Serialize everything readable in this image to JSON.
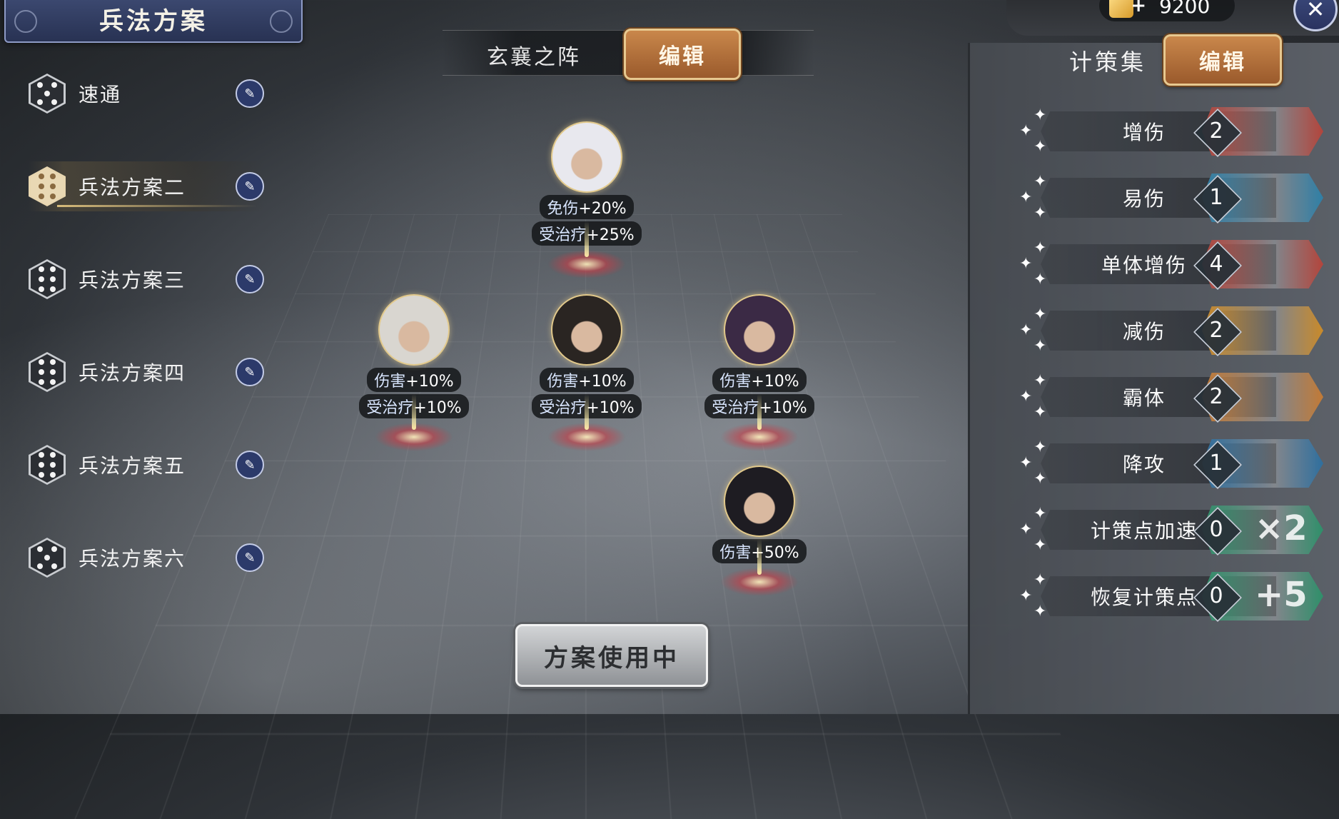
{
  "left_panel": {
    "title": "兵法方案",
    "plans": [
      {
        "label": "速通",
        "pips": 5,
        "active": false
      },
      {
        "label": "兵法方案二",
        "pips": 6,
        "active": true
      },
      {
        "label": "兵法方案三",
        "pips": 6,
        "active": false
      },
      {
        "label": "兵法方案四",
        "pips": 6,
        "active": false
      },
      {
        "label": "兵法方案五",
        "pips": 6,
        "active": false
      },
      {
        "label": "兵法方案六",
        "pips": 5,
        "active": false
      }
    ]
  },
  "formation": {
    "name": "玄襄之阵",
    "edit_label": "编辑"
  },
  "characters": [
    {
      "id": "top",
      "stats": [
        {
          "k": "免伤",
          "v": "+20%"
        },
        {
          "k": "受治疗",
          "v": "+25%"
        }
      ],
      "hair": "#e8e8ee"
    },
    {
      "id": "left",
      "stats": [
        {
          "k": "伤害",
          "v": "+10%"
        },
        {
          "k": "受治疗",
          "v": "+10%"
        }
      ],
      "hair": "#d9d6d0"
    },
    {
      "id": "center",
      "stats": [
        {
          "k": "伤害",
          "v": "+10%"
        },
        {
          "k": "受治疗",
          "v": "+10%"
        }
      ],
      "hair": "#2a2522"
    },
    {
      "id": "right",
      "stats": [
        {
          "k": "伤害",
          "v": "+10%"
        },
        {
          "k": "受治疗",
          "v": "+10%"
        }
      ],
      "hair": "#3b2a45"
    },
    {
      "id": "bottom",
      "stats": [
        {
          "k": "伤害",
          "v": "+50%"
        }
      ],
      "hair": "#1e1c22"
    }
  ],
  "use_button": "方案使用中",
  "right_panel": {
    "currency": "9200",
    "title": "计策集",
    "edit_label": "编辑",
    "strategies": [
      {
        "name": "增伤",
        "count": "2",
        "color": "#b3453c",
        "glyph": ""
      },
      {
        "name": "易伤",
        "count": "1",
        "color": "#2f7fa6",
        "glyph": ""
      },
      {
        "name": "单体增伤",
        "count": "4",
        "color": "#b3453c",
        "glyph": ""
      },
      {
        "name": "减伤",
        "count": "2",
        "color": "#c98a2a",
        "glyph": ""
      },
      {
        "name": "霸体",
        "count": "2",
        "color": "#c27a36",
        "glyph": ""
      },
      {
        "name": "降攻",
        "count": "1",
        "color": "#2f6f9e",
        "glyph": ""
      },
      {
        "name": "计策点加速",
        "count": "0",
        "color": "#2f8f6a",
        "glyph": "×2"
      },
      {
        "name": "恢复计策点",
        "count": "0",
        "color": "#2f8f6a",
        "glyph": "+5"
      }
    ]
  },
  "colors": {
    "gold_border": "#e7c88f",
    "button_gold": "#b9753e",
    "panel_dark": "#2a2c30"
  }
}
